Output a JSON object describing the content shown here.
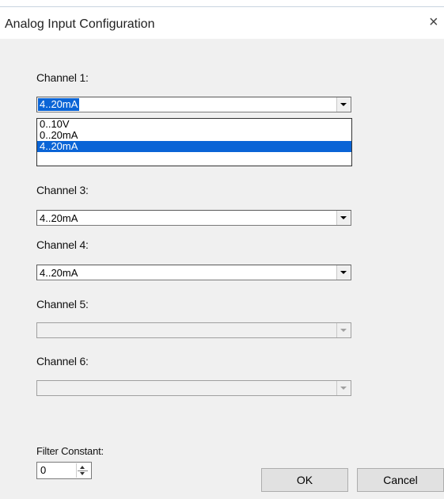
{
  "window": {
    "title": "Analog Input Configuration",
    "close_glyph": "×"
  },
  "channels": [
    {
      "label": "Channel 1:",
      "value": "4..20mA",
      "enabled": true,
      "open": true
    },
    {
      "label": "Channel 3:",
      "value": "4..20mA",
      "enabled": true
    },
    {
      "label": "Channel 4:",
      "value": "4..20mA",
      "enabled": true
    },
    {
      "label": "Channel 5:",
      "value": "",
      "enabled": false
    },
    {
      "label": "Channel 6:",
      "value": "",
      "enabled": false
    }
  ],
  "dropdown_options": [
    "0..10V",
    "0..20mA",
    "4..20mA"
  ],
  "dropdown_selected": "4..20mA",
  "filter": {
    "label": "Filter Constant:",
    "value": "0"
  },
  "buttons": {
    "ok": "OK",
    "cancel": "Cancel"
  },
  "colors": {
    "selection": "#0a64d6",
    "dialog_bg": "#f0f0f0"
  }
}
